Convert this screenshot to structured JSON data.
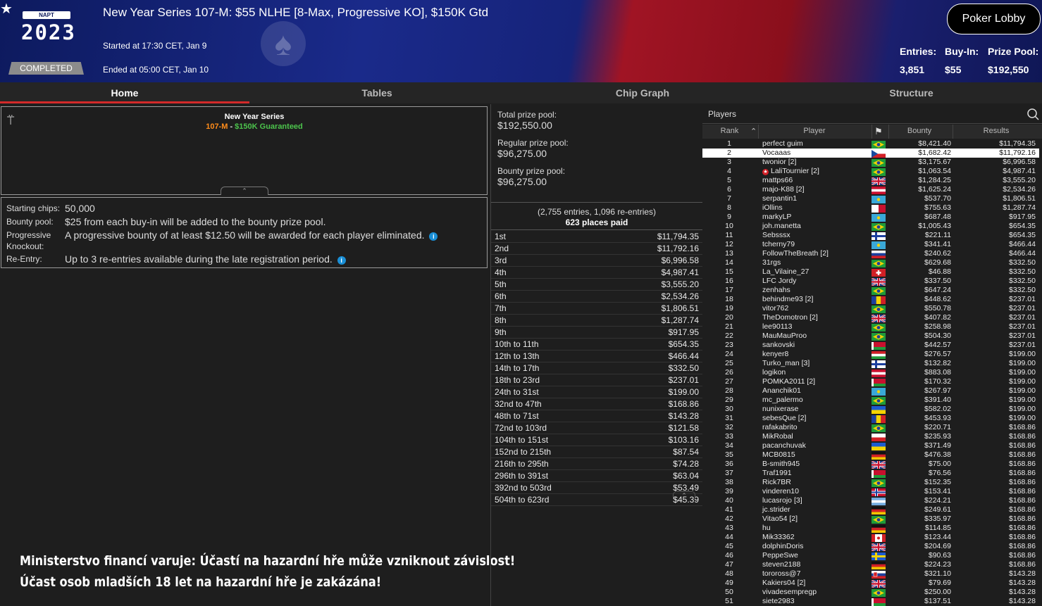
{
  "header": {
    "logo_small": "NAPT",
    "logo_year": "2023",
    "status": "COMPLETED",
    "title": "New Year Series 107-M: $55 NLHE [8-Max, Progressive KO], $150K Gtd",
    "started": "Started at 17:30 CET, Jan 9",
    "ended": "Ended at 05:00 CET, Jan 10",
    "lobby_button": "Poker Lobby",
    "entries_label": "Entries:",
    "entries_value": "3,851",
    "buyin_label": "Buy-In:",
    "buyin_value": "$55",
    "prizepool_label": "Prize Pool:",
    "prizepool_value": "$192,550"
  },
  "tabs": [
    "Home",
    "Tables",
    "Chip Graph",
    "Structure"
  ],
  "banner": {
    "title": "New Year Series",
    "code": "107-M",
    "sep": " - ",
    "guarantee": "$150K Guaranteed"
  },
  "info": {
    "starting_chips_label": "Starting chips:",
    "starting_chips_value": "50,000",
    "bounty_pool_label": "Bounty pool:",
    "bounty_pool_value": "$25 from each buy-in will be added to the bounty prize pool.",
    "pko_label_1": "Progressive",
    "pko_label_2": "Knockout:",
    "pko_value": "A progressive bounty of at least $12.50 will be awarded for each player eliminated.",
    "reentry_label": "Re-Entry:",
    "reentry_value": "Up to 3 re-entries available during the late registration period."
  },
  "prize": {
    "total_label": "Total prize pool:",
    "total_value": "$192,550.00",
    "regular_label": "Regular prize pool:",
    "regular_value": "$96,275.00",
    "bounty_label": "Bounty prize pool:",
    "bounty_value": "$96,275.00",
    "entries_note": "(2,755 entries, 1,096 re-entries)",
    "places_paid": "623 places paid",
    "payouts": [
      [
        "1st",
        "$11,794.35"
      ],
      [
        "2nd",
        "$11,792.16"
      ],
      [
        "3rd",
        "$6,996.58"
      ],
      [
        "4th",
        "$4,987.41"
      ],
      [
        "5th",
        "$3,555.20"
      ],
      [
        "6th",
        "$2,534.26"
      ],
      [
        "7th",
        "$1,806.51"
      ],
      [
        "8th",
        "$1,287.74"
      ],
      [
        "9th",
        "$917.95"
      ],
      [
        "10th to 11th",
        "$654.35"
      ],
      [
        "12th to 13th",
        "$466.44"
      ],
      [
        "14th to 17th",
        "$332.50"
      ],
      [
        "18th to 23rd",
        "$237.01"
      ],
      [
        "24th to 31st",
        "$199.00"
      ],
      [
        "32nd to 47th",
        "$168.86"
      ],
      [
        "48th to 71st",
        "$143.28"
      ],
      [
        "72nd to 103rd",
        "$121.58"
      ],
      [
        "104th to 151st",
        "$103.16"
      ],
      [
        "152nd to 215th",
        "$87.54"
      ],
      [
        "216th to 295th",
        "$74.28"
      ],
      [
        "296th to 391st",
        "$63.04"
      ],
      [
        "392nd to 503rd",
        "$53.49"
      ],
      [
        "504th to 623rd",
        "$45.39"
      ]
    ]
  },
  "players": {
    "title": "Players",
    "columns": {
      "rank": "Rank",
      "player": "Player",
      "bounty": "Bounty",
      "results": "Results"
    },
    "rows": [
      [
        "1",
        "perfect guim",
        "br",
        "$8,421.40",
        "$11,794.35"
      ],
      [
        "2",
        "Vocaaas",
        "cz",
        "$1,682.42",
        "$11,792.16"
      ],
      [
        "3",
        "twonior [2]",
        "br",
        "$3,175.67",
        "$6,996.58"
      ],
      [
        "4",
        "LaliTournier [2]",
        "br",
        "$1,063.54",
        "$4,987.41"
      ],
      [
        "5",
        "mattps66",
        "gb",
        "$1,284.25",
        "$3,555.20"
      ],
      [
        "6",
        "majo-K88 [2]",
        "at",
        "$1,625.24",
        "$2,534.26"
      ],
      [
        "7",
        "serpantin1",
        "kz",
        "$537.70",
        "$1,806.51"
      ],
      [
        "8",
        "iOllins",
        "mt",
        "$755.63",
        "$1,287.74"
      ],
      [
        "9",
        "markyLP",
        "kz",
        "$687.48",
        "$917.95"
      ],
      [
        "10",
        "joh.manetta",
        "br",
        "$1,005.43",
        "$654.35"
      ],
      [
        "11",
        "Sebsssx",
        "fi",
        "$221.11",
        "$654.35"
      ],
      [
        "12",
        "tcherny79",
        "kz",
        "$341.41",
        "$466.44"
      ],
      [
        "13",
        "FollowTheBreath [2]",
        "ru",
        "$240.62",
        "$466.44"
      ],
      [
        "14",
        "31rgs",
        "br",
        "$629.68",
        "$332.50"
      ],
      [
        "15",
        "La_Vilaine_27",
        "ch",
        "$46.88",
        "$332.50"
      ],
      [
        "16",
        "LFC Jordy",
        "gb",
        "$337.50",
        "$332.50"
      ],
      [
        "17",
        "zenhahs",
        "br",
        "$647.24",
        "$332.50"
      ],
      [
        "18",
        "behindme93 [2]",
        "ro",
        "$448.62",
        "$237.01"
      ],
      [
        "19",
        "vitor762",
        "br",
        "$550.78",
        "$237.01"
      ],
      [
        "20",
        "TheDomotron [2]",
        "gb",
        "$407.82",
        "$237.01"
      ],
      [
        "21",
        "lee90113",
        "br",
        "$258.98",
        "$237.01"
      ],
      [
        "22",
        "MauMauProo",
        "br",
        "$504.30",
        "$237.01"
      ],
      [
        "23",
        "sankovski",
        "by",
        "$442.57",
        "$237.01"
      ],
      [
        "24",
        "kenyer8",
        "hu",
        "$276.57",
        "$199.00"
      ],
      [
        "25",
        "Turko_man [3]",
        "fi",
        "$132.82",
        "$199.00"
      ],
      [
        "26",
        "logikon",
        "at",
        "$883.08",
        "$199.00"
      ],
      [
        "27",
        "POMKA2011 [2]",
        "by",
        "$170.32",
        "$199.00"
      ],
      [
        "28",
        "Ananchik01",
        "kz",
        "$267.97",
        "$199.00"
      ],
      [
        "29",
        "mc_palermo",
        "br",
        "$391.40",
        "$199.00"
      ],
      [
        "30",
        "nunixerase",
        "ua",
        "$582.02",
        "$199.00"
      ],
      [
        "31",
        "sebesQue [2]",
        "ro",
        "$453.93",
        "$199.00"
      ],
      [
        "32",
        "rafakabrito",
        "br",
        "$220.71",
        "$168.86"
      ],
      [
        "33",
        "MikRobal",
        "pl",
        "$235.93",
        "$168.86"
      ],
      [
        "34",
        "pacanchuvak",
        "ua",
        "$371.49",
        "$168.86"
      ],
      [
        "35",
        "MCB0815",
        "de",
        "$476.38",
        "$168.86"
      ],
      [
        "36",
        "B-smith945",
        "gb",
        "$75.00",
        "$168.86"
      ],
      [
        "37",
        "Traf1991",
        "by",
        "$76.56",
        "$168.86"
      ],
      [
        "38",
        "Rick7BR",
        "br",
        "$152.35",
        "$168.86"
      ],
      [
        "39",
        "vinderen10",
        "no",
        "$153.41",
        "$168.86"
      ],
      [
        "40",
        "lucasrojo [3]",
        "ar",
        "$224.21",
        "$168.86"
      ],
      [
        "41",
        "jc.strider",
        "de",
        "$249.61",
        "$168.86"
      ],
      [
        "42",
        "Vitao54 [2]",
        "br",
        "$335.97",
        "$168.86"
      ],
      [
        "43",
        "hu",
        "de",
        "$114.85",
        "$168.86"
      ],
      [
        "44",
        "Mik33362",
        "ca",
        "$123.44",
        "$168.86"
      ],
      [
        "45",
        "dolphinDoris",
        "gb",
        "$204.69",
        "$168.86"
      ],
      [
        "46",
        "PeppeSwe",
        "se",
        "$90.63",
        "$168.86"
      ],
      [
        "47",
        "steven2188",
        "de",
        "$224.23",
        "$168.86"
      ],
      [
        "48",
        "toroross@7",
        "sk",
        "$321.10",
        "$143.28"
      ],
      [
        "49",
        "Kakiers04 [2]",
        "gb",
        "$79.69",
        "$143.28"
      ],
      [
        "50",
        "vivadesempregp",
        "br",
        "$250.00",
        "$143.28"
      ],
      [
        "51",
        "siete2983",
        "by",
        "$137.51",
        "$143.28"
      ]
    ],
    "selected_rank": "2"
  },
  "warning": {
    "line1": "Ministerstvo financí varuje: Účastí na hazardní hře může vzniknout závislost!",
    "line2": "Účast osob mladších 18 let na hazardní hře je zakázána!"
  },
  "colors": {
    "accent_red": "#d32a2a",
    "code_orange": "#ff8c1a",
    "guarantee_green": "#4cc44c",
    "info_blue": "#1a8fd6"
  }
}
